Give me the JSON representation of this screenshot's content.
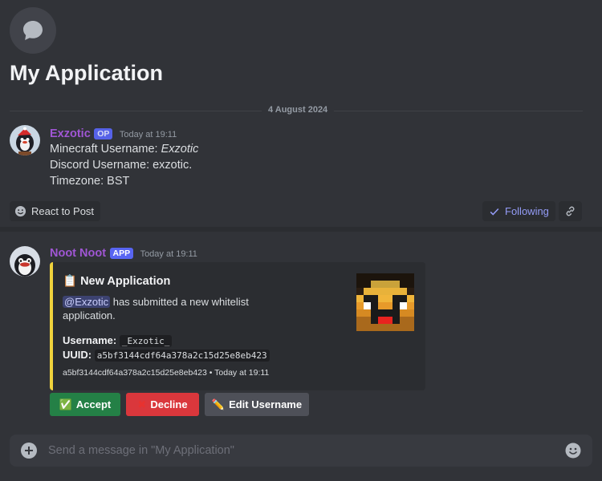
{
  "channel": {
    "title": "My Application",
    "icon": "chat-bubble-icon"
  },
  "date_divider": "4 August 2024",
  "post": {
    "author": "Exzotic",
    "badge": "OP",
    "timestamp": "Today at 19:11",
    "lines": {
      "minecraft_label": "Minecraft Username: ",
      "minecraft_value": "Exzotic",
      "discord": "Discord Username: exzotic.",
      "timezone": "Timezone: BST"
    }
  },
  "post_actions": {
    "react_label": "React to Post",
    "following_label": "Following"
  },
  "bot_message": {
    "author": "Noot Noot",
    "badge": "APP",
    "timestamp": "Today at 19:11",
    "embed": {
      "accent_color": "#f0d23c",
      "title_emoji": "📋",
      "title": "New Application",
      "mention": "@Exzotic",
      "description_rest": " has submitted a new whitelist application.",
      "username_label": "Username:",
      "username_value": "_Exzotic_",
      "uuid_label": "UUID:",
      "uuid_value": "a5bf3144cdf64a378a2c15d25e8eb423",
      "footer": "a5bf3144cdf64a378a2c15d25e8eb423 • Today at 19:11"
    },
    "buttons": {
      "accept_emoji": "✅",
      "accept": "Accept",
      "decline_emoji": "✖",
      "decline": "Decline",
      "edit_emoji": "✏️",
      "edit": "Edit Username"
    }
  },
  "composer": {
    "placeholder": "Send a message in \"My Application\""
  },
  "colors": {
    "background": "#313338",
    "author_purple": "#a056d4",
    "blurple": "#5865f2",
    "accept_green": "#248046",
    "decline_red": "#da373c"
  }
}
